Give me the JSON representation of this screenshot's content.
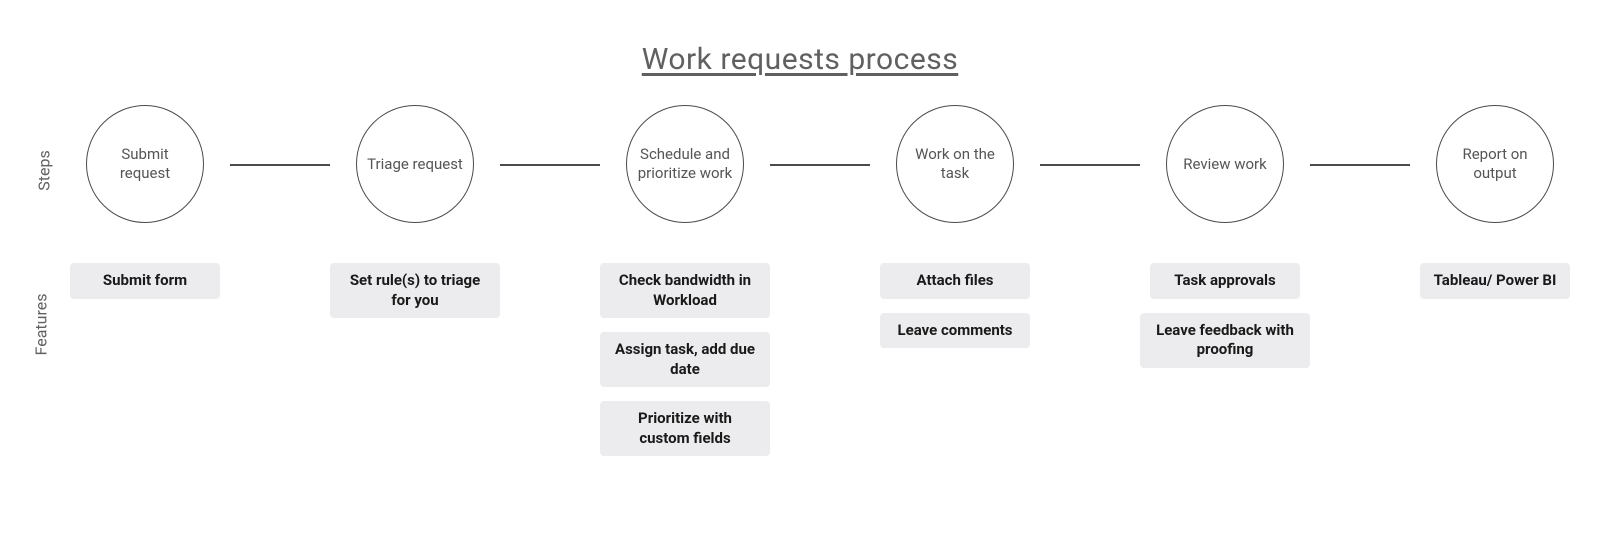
{
  "title": "Work requests process",
  "row_labels": {
    "steps": "Steps",
    "features": "Features"
  },
  "columns": [
    {
      "step": "Submit request",
      "features": [
        "Submit form"
      ]
    },
    {
      "step": "Triage request",
      "features": [
        "Set rule(s) to triage for you"
      ]
    },
    {
      "step": "Schedule and prioritize work",
      "features": [
        "Check bandwidth in Workload",
        "Assign task, add due date",
        "Prioritize with custom fields"
      ]
    },
    {
      "step": "Work on the task",
      "features": [
        "Attach files",
        "Leave comments"
      ]
    },
    {
      "step": "Review work",
      "features": [
        "Task approvals",
        "Leave feedback with proofing"
      ]
    },
    {
      "step": "Report on output",
      "features": [
        "Tableau/ Power BI"
      ]
    }
  ]
}
